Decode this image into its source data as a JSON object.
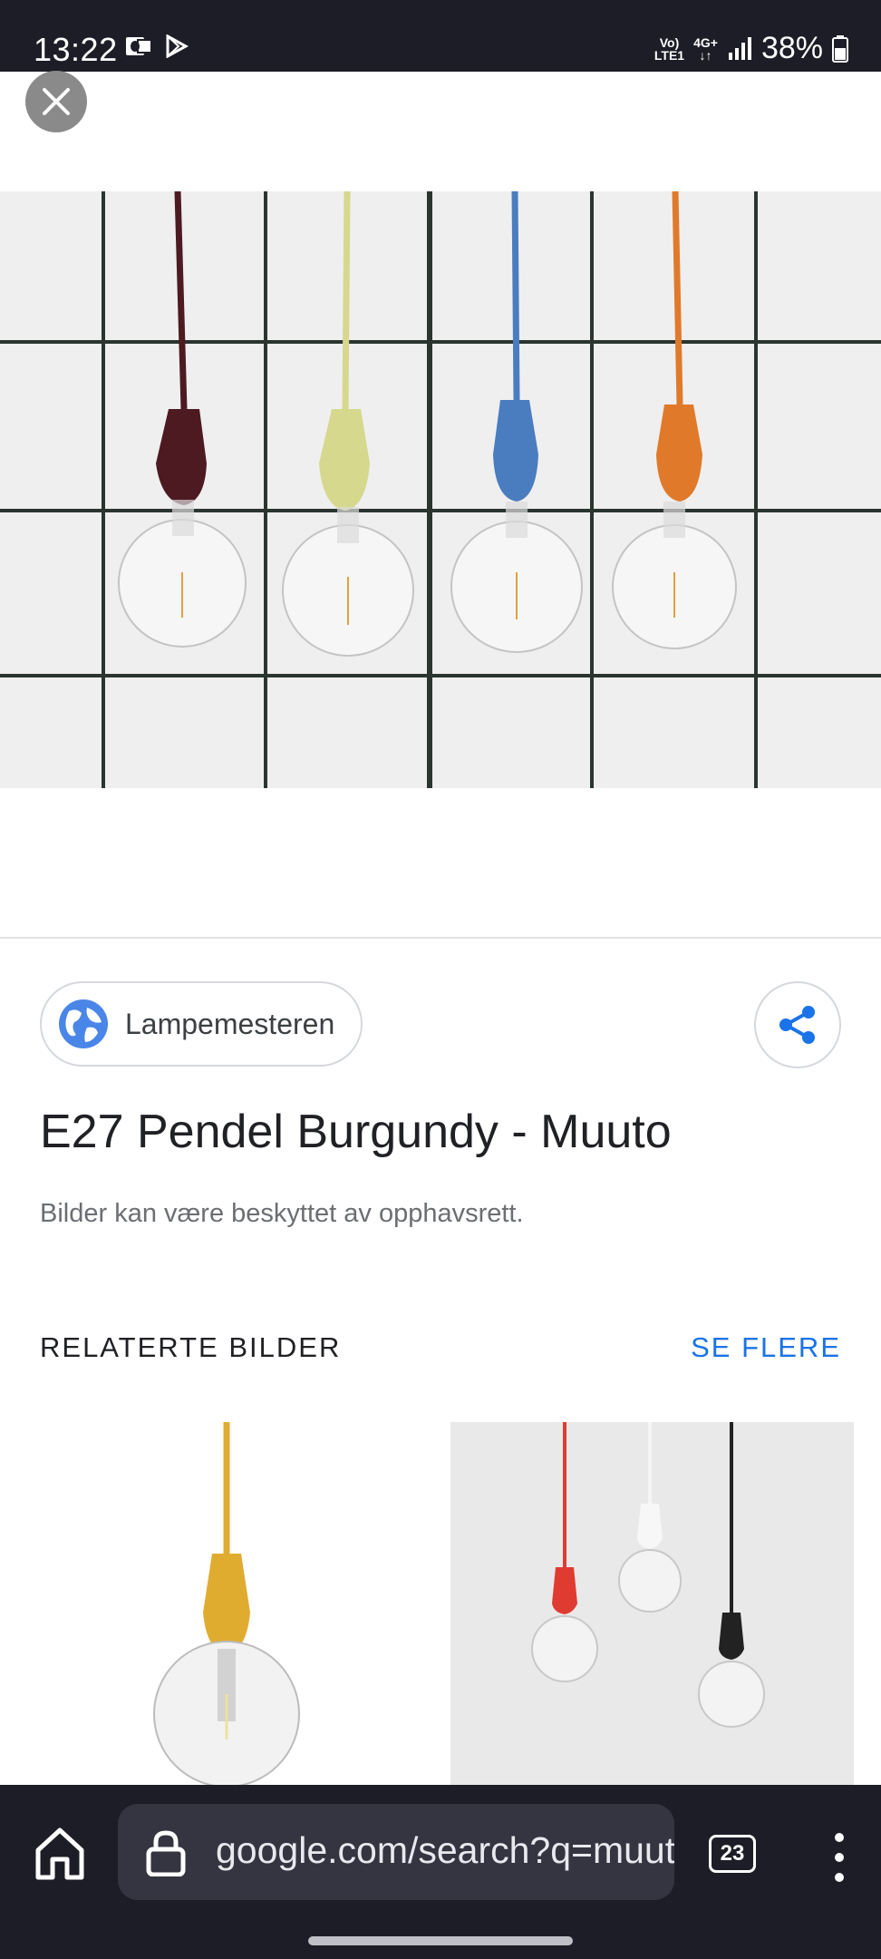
{
  "status_bar": {
    "time": "13:22",
    "volte_top": "Vo)",
    "volte_bottom": "LTE1",
    "network_top": "4G+",
    "network_bottom": "↓↑",
    "battery": "38%"
  },
  "viewer": {
    "source_name": "Lampemesteren",
    "title": "E27 Pendel Burgundy - Muuto",
    "copyright_notice": "Bilder kan være beskyttet av opphavsrett.",
    "related_heading": "RELATERTE BILDER",
    "see_more_label": "SE FLERE"
  },
  "browser": {
    "url": "google.com/search?q=muuto",
    "tab_count": "23"
  },
  "colors": {
    "link_blue": "#1a73e8",
    "bar_dark": "#1d1d27",
    "cord_burgundy": "#4d1a22",
    "cord_yellow": "#d6d88e",
    "cord_blue": "#4a7dc0",
    "cord_orange": "#e07a2a",
    "cord_mustard": "#e0ac30"
  }
}
